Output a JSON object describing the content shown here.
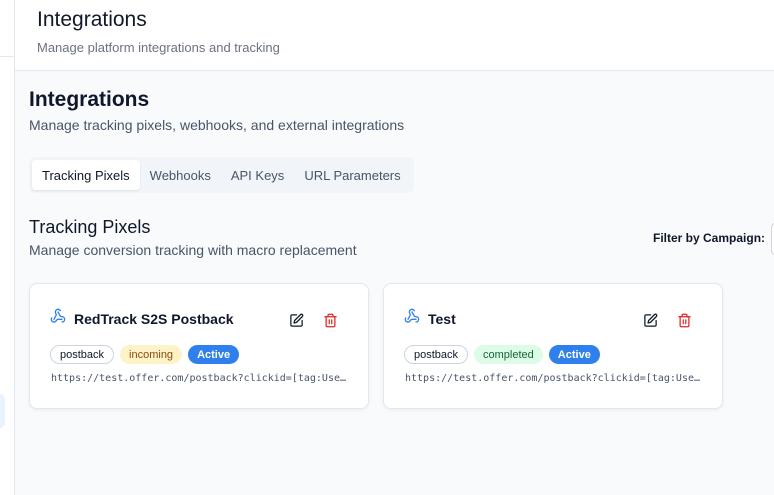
{
  "header": {
    "title": "Integrations",
    "subtitle": "Manage platform integrations and tracking"
  },
  "page": {
    "title": "Integrations",
    "subtitle": "Manage tracking pixels, webhooks, and external integrations"
  },
  "tabs": [
    {
      "label": "Tracking Pixels",
      "active": true
    },
    {
      "label": "Webhooks",
      "active": false
    },
    {
      "label": "API Keys",
      "active": false
    },
    {
      "label": "URL Parameters",
      "active": false
    }
  ],
  "section": {
    "title": "Tracking Pixels",
    "subtitle": "Manage conversion tracking with macro replacement",
    "filter_label": "Filter by Campaign:"
  },
  "pixels": [
    {
      "name": "RedTrack S2S Postback",
      "icon": "webhook-icon",
      "type": "postback",
      "event": "incoming",
      "status": "Active",
      "url": "https://test.offer.com/postback?clickid=[tag:User Id]&status=incoming"
    },
    {
      "name": "Test",
      "icon": "webhook-icon",
      "type": "postback",
      "event": "completed",
      "status": "Active",
      "url": "https://test.offer.com/postback?clickid=[tag:User Id]&status=completed"
    }
  ],
  "colors": {
    "accent": "#2f80ed",
    "delete": "#dc2626",
    "incoming_bg": "#fef3c7",
    "completed_bg": "#dcfce7"
  }
}
